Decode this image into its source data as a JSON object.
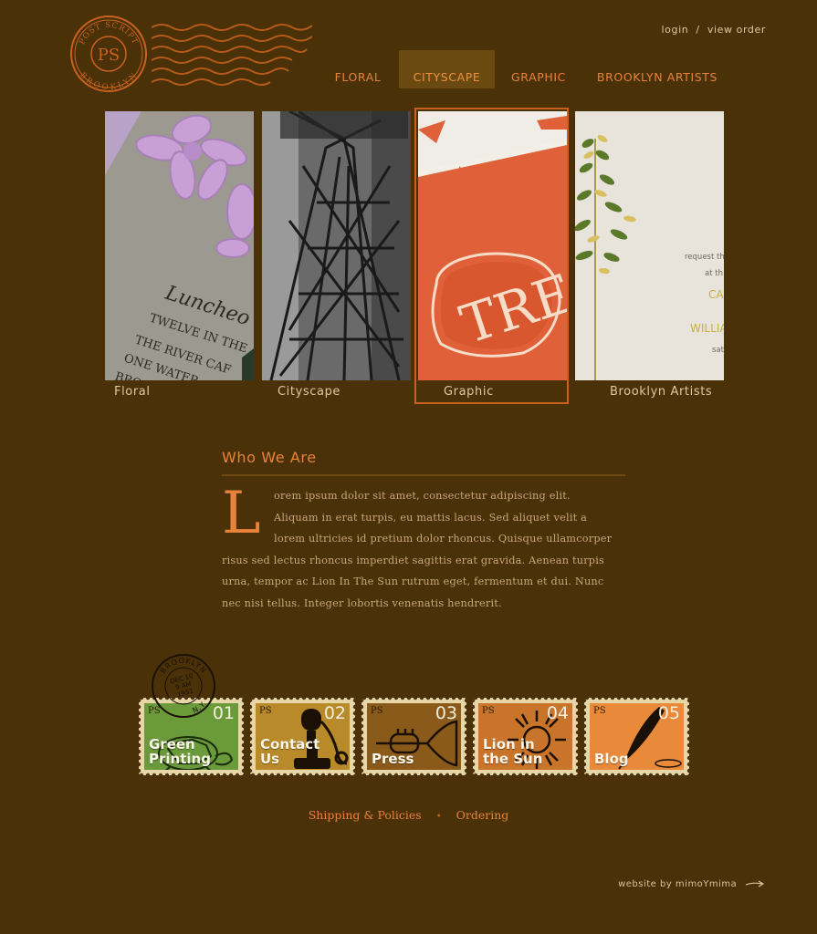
{
  "brand": {
    "logo_top": "POST SCRIPT",
    "logo_monogram": "PS",
    "logo_bottom": "BROOKLYN",
    "accent": "#e8823a",
    "background": "#4a3108"
  },
  "account": {
    "login": "login",
    "separator": "/",
    "view_order": "view order"
  },
  "nav": [
    {
      "label": "FLORAL",
      "active": false
    },
    {
      "label": "CITYSCAPE",
      "active": true
    },
    {
      "label": "GRAPHIC",
      "active": false
    },
    {
      "label": "BROOKLYN ARTISTS",
      "active": false
    }
  ],
  "gallery": [
    {
      "caption": "Floral",
      "card_text": [
        "Luncheo",
        "TWELVE IN THE",
        "THE RIVER CAF",
        "ONE WATER",
        "BROO"
      ]
    },
    {
      "caption": "Cityscape"
    },
    {
      "caption": "Graphic",
      "card_text": "TRE"
    },
    {
      "caption": "Brooklyn Artists",
      "card_text": [
        "request th",
        "at th",
        "CA",
        "WILLIA",
        "satu"
      ]
    }
  ],
  "about": {
    "heading": "Who We Are",
    "drop_cap": "L",
    "body": "orem ipsum dolor sit amet, consectetur adipiscing elit. Aliquam in erat turpis, eu mattis lacus. Sed aliquet velit a lorem ultricies id pretium dolor rhoncus. Quisque ullamcorper risus sed lectus rhoncus imperdiet sagittis erat gravida. Aenean turpis urna, tempor ac Lion In The Sun rutrum eget, fermentum et dui. Nunc nec nisi tellus. Integer lobortis venenatis hendrerit."
  },
  "postmark": {
    "top": "BROOKLYN",
    "date": [
      "DEC 10",
      "9 AM",
      "1951"
    ],
    "bottom": "N.Y."
  },
  "stamps": [
    {
      "prefix": "PS",
      "number": "01",
      "label_lines": [
        "Green",
        "Printing"
      ],
      "color": "#6a9a3a",
      "icon": "turtle-icon"
    },
    {
      "prefix": "PS",
      "number": "02",
      "label_lines": [
        "Contact",
        "Us"
      ],
      "color": "#b88a2a",
      "icon": "telephone-icon"
    },
    {
      "prefix": "PS",
      "number": "03",
      "label_lines": [
        "Press"
      ],
      "color": "#8a5a1a",
      "icon": "trumpet-icon"
    },
    {
      "prefix": "PS",
      "number": "04",
      "label_lines": [
        "Lion in",
        "the Sun"
      ],
      "color": "#c8742a",
      "icon": "sun-icon"
    },
    {
      "prefix": "PS",
      "number": "05",
      "label_lines": [
        "Blog"
      ],
      "color": "#e88a3a",
      "icon": "quill-icon"
    }
  ],
  "footer": {
    "links": [
      "Shipping & Policies",
      "Ordering"
    ],
    "separator": "•"
  },
  "credit": {
    "text": "website by mimoYmima"
  }
}
